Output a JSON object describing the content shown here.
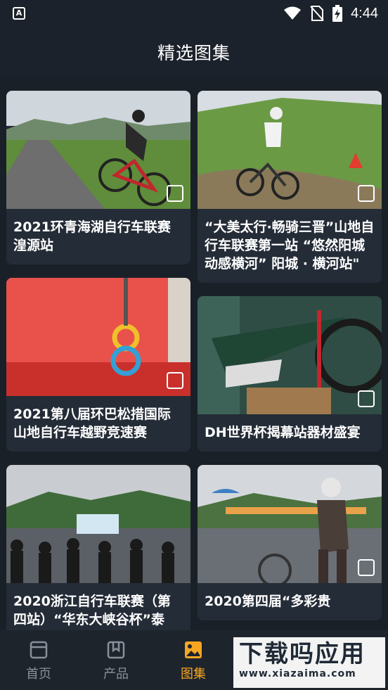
{
  "status_bar": {
    "time": "4:44",
    "app_badge": "A"
  },
  "header": {
    "title": "精选图集"
  },
  "cards": [
    {
      "caption": "2021环青海湖自行车联赛湟源站"
    },
    {
      "caption": "“大美太行·畅骑三晋”山地自行车联赛第一站 “悠然阳城 动感横河” 阳城 · 横河站\""
    },
    {
      "caption": "2021第八届环巴松措国际山地自行车越野竞速赛"
    },
    {
      "caption": "DH世界杯揭幕站器材盛宴"
    },
    {
      "caption": "2020浙江自行车联赛（第四站）“华东大峡谷杯”泰"
    },
    {
      "caption": "2020第四届“多彩贵"
    }
  ],
  "tabs": [
    {
      "label": "首页",
      "icon": "home-icon",
      "active": false
    },
    {
      "label": "产品",
      "icon": "product-icon",
      "active": false
    },
    {
      "label": "图集",
      "icon": "gallery-icon",
      "active": true
    }
  ],
  "watermark": {
    "top": "下载吗应用",
    "bottom": "www.xiazaima.com"
  },
  "colors": {
    "accent": "#f6a623",
    "background": "#1c222b",
    "card": "#242c37"
  }
}
